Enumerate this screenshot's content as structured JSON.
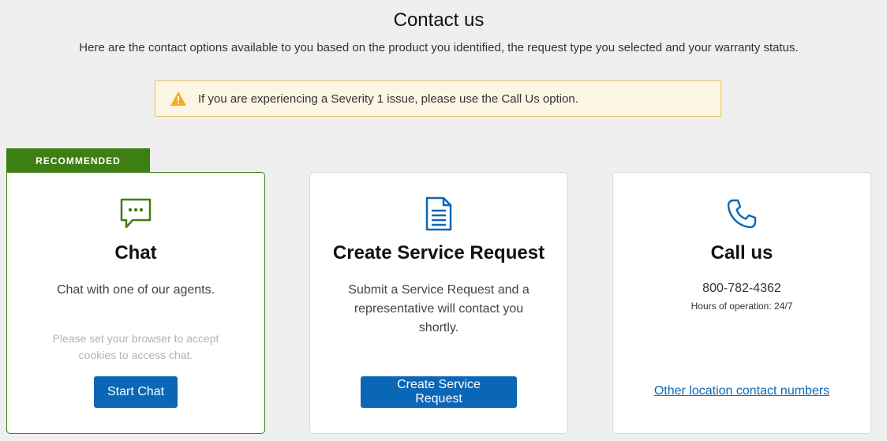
{
  "header": {
    "title": "Contact us",
    "subtitle": "Here are the contact options available to you based on the product you identified, the request type you selected and your warranty status."
  },
  "alert": {
    "icon": "warning-icon",
    "text": "If you are experiencing a Severity 1 issue, please use the Call Us option."
  },
  "badge": {
    "label": "RECOMMENDED"
  },
  "cards": {
    "chat": {
      "icon": "chat-bubble-icon",
      "title": "Chat",
      "description": "Chat with one of our agents.",
      "note": "Please set your browser to accept cookies to access chat.",
      "button_label": "Start Chat"
    },
    "service_request": {
      "icon": "document-icon",
      "title": "Create Service Request",
      "description": "Submit a Service Request and a representative will contact you shortly.",
      "button_label": "Create Service Request"
    },
    "call": {
      "icon": "phone-icon",
      "title": "Call us",
      "phone": "800-782-4362",
      "hours": "Hours of operation: 24/7",
      "link_label": "Other location contact numbers"
    }
  },
  "colors": {
    "background": "#efefef",
    "brand_blue": "#0a67b6",
    "recommended_green": "#3d7f12",
    "alert_background": "#fdf5e3",
    "alert_border": "#e7c76c",
    "warning_icon": "#f0ad1c"
  }
}
